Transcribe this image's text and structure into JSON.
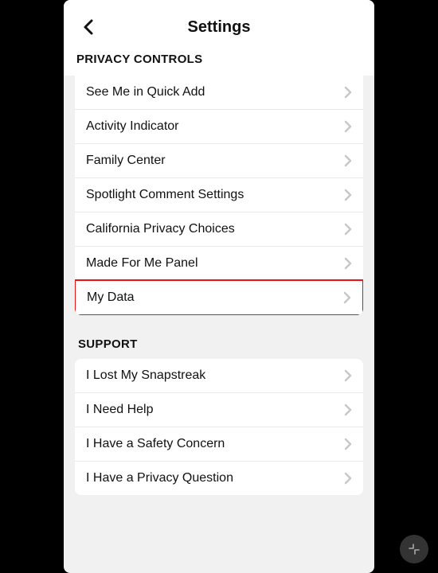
{
  "header": {
    "title": "Settings"
  },
  "sections": {
    "privacy": {
      "title": "PRIVACY CONTROLS",
      "items": [
        {
          "label": "See Me in Quick Add"
        },
        {
          "label": "Activity Indicator"
        },
        {
          "label": "Family Center"
        },
        {
          "label": "Spotlight Comment Settings"
        },
        {
          "label": "California Privacy Choices"
        },
        {
          "label": "Made For Me Panel"
        },
        {
          "label": "My Data",
          "highlight": true
        }
      ]
    },
    "support": {
      "title": "SUPPORT",
      "items": [
        {
          "label": "I Lost My Snapstreak"
        },
        {
          "label": "I Need Help"
        },
        {
          "label": "I Have a Safety Concern"
        },
        {
          "label": "I Have a Privacy Question"
        }
      ]
    }
  }
}
